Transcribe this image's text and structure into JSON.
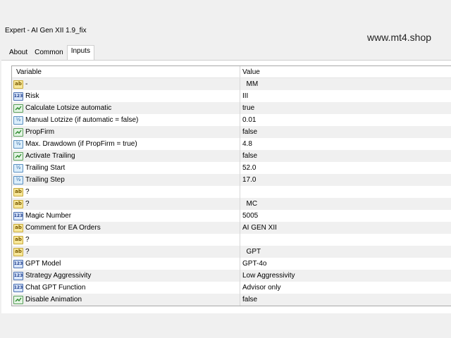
{
  "window": {
    "title": "Expert - AI Gen XII 1.9_fix"
  },
  "watermark": "www.mt4.shop",
  "tabs": [
    {
      "label": "About",
      "active": false
    },
    {
      "label": "Common",
      "active": false
    },
    {
      "label": "Inputs",
      "active": true
    }
  ],
  "grid": {
    "headers": {
      "variable": "Variable",
      "value": "Value"
    },
    "rows": [
      {
        "icon": "string-icon",
        "variable": "-",
        "value": "  MM"
      },
      {
        "icon": "integer-icon",
        "variable": "Risk",
        "value": "III"
      },
      {
        "icon": "bool-icon",
        "variable": "Calculate Lotsize automatic",
        "value": "true"
      },
      {
        "icon": "double-icon",
        "variable": "Manual Lotzize (if automatic = false)",
        "value": "0.01"
      },
      {
        "icon": "bool-icon",
        "variable": "PropFirm",
        "value": "false"
      },
      {
        "icon": "double-icon",
        "variable": "Max. Drawdown (if PropFirm = true)",
        "value": "4.8"
      },
      {
        "icon": "bool-icon",
        "variable": "Activate Trailing",
        "value": "false"
      },
      {
        "icon": "double-icon",
        "variable": "Trailing Start",
        "value": "52.0"
      },
      {
        "icon": "double-icon",
        "variable": "Trailing Step",
        "value": "17.0"
      },
      {
        "icon": "string-icon",
        "variable": "?",
        "value": ""
      },
      {
        "icon": "string-icon",
        "variable": "?",
        "value": "  MC"
      },
      {
        "icon": "integer-icon",
        "variable": "Magic Number",
        "value": "5005"
      },
      {
        "icon": "string-icon",
        "variable": "Comment for EA Orders",
        "value": "AI GEN XII"
      },
      {
        "icon": "string-icon",
        "variable": "?",
        "value": ""
      },
      {
        "icon": "string-icon",
        "variable": "?",
        "value": "  GPT"
      },
      {
        "icon": "integer-icon",
        "variable": "GPT Model",
        "value": "GPT-4o"
      },
      {
        "icon": "integer-icon",
        "variable": "Strategy Aggressivity",
        "value": "Low Aggressivity"
      },
      {
        "icon": "integer-icon",
        "variable": "Chat GPT Function",
        "value": "Advisor only"
      },
      {
        "icon": "bool-icon",
        "variable": "Disable Animation",
        "value": "false"
      }
    ]
  }
}
